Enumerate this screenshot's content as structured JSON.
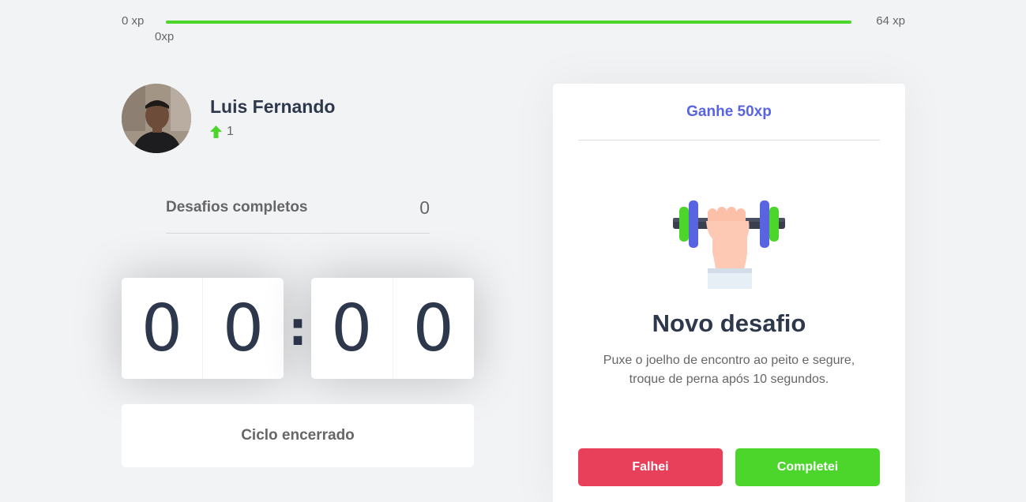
{
  "experience": {
    "min_label": "0 xp",
    "max_label": "64 xp",
    "current_label": "0xp",
    "progress_percent": 100
  },
  "profile": {
    "name": "Luis Fernando",
    "level": "1",
    "level_icon": "level-up-arrow-icon"
  },
  "completed_challenges": {
    "label": "Desafios completos",
    "value": "0"
  },
  "countdown": {
    "minute_left": "0",
    "minute_right": "0",
    "separator": ":",
    "second_left": "0",
    "second_right": "0"
  },
  "cycle_button": {
    "label": "Ciclo encerrado"
  },
  "challenge": {
    "header": "Ganhe 50xp",
    "title": "Novo desafio",
    "description": "Puxe o joelho de encontro ao peito e segure, troque de perna após 10 segundos.",
    "illustration": "dumbbell-arm-icon",
    "fail_label": "Falhei",
    "success_label": "Completei"
  },
  "colors": {
    "green": "#4cd62b",
    "red": "#e83f5b",
    "blue": "#5965e0",
    "title": "#2e384d",
    "text": "#666666",
    "background": "#f2f3f5"
  }
}
